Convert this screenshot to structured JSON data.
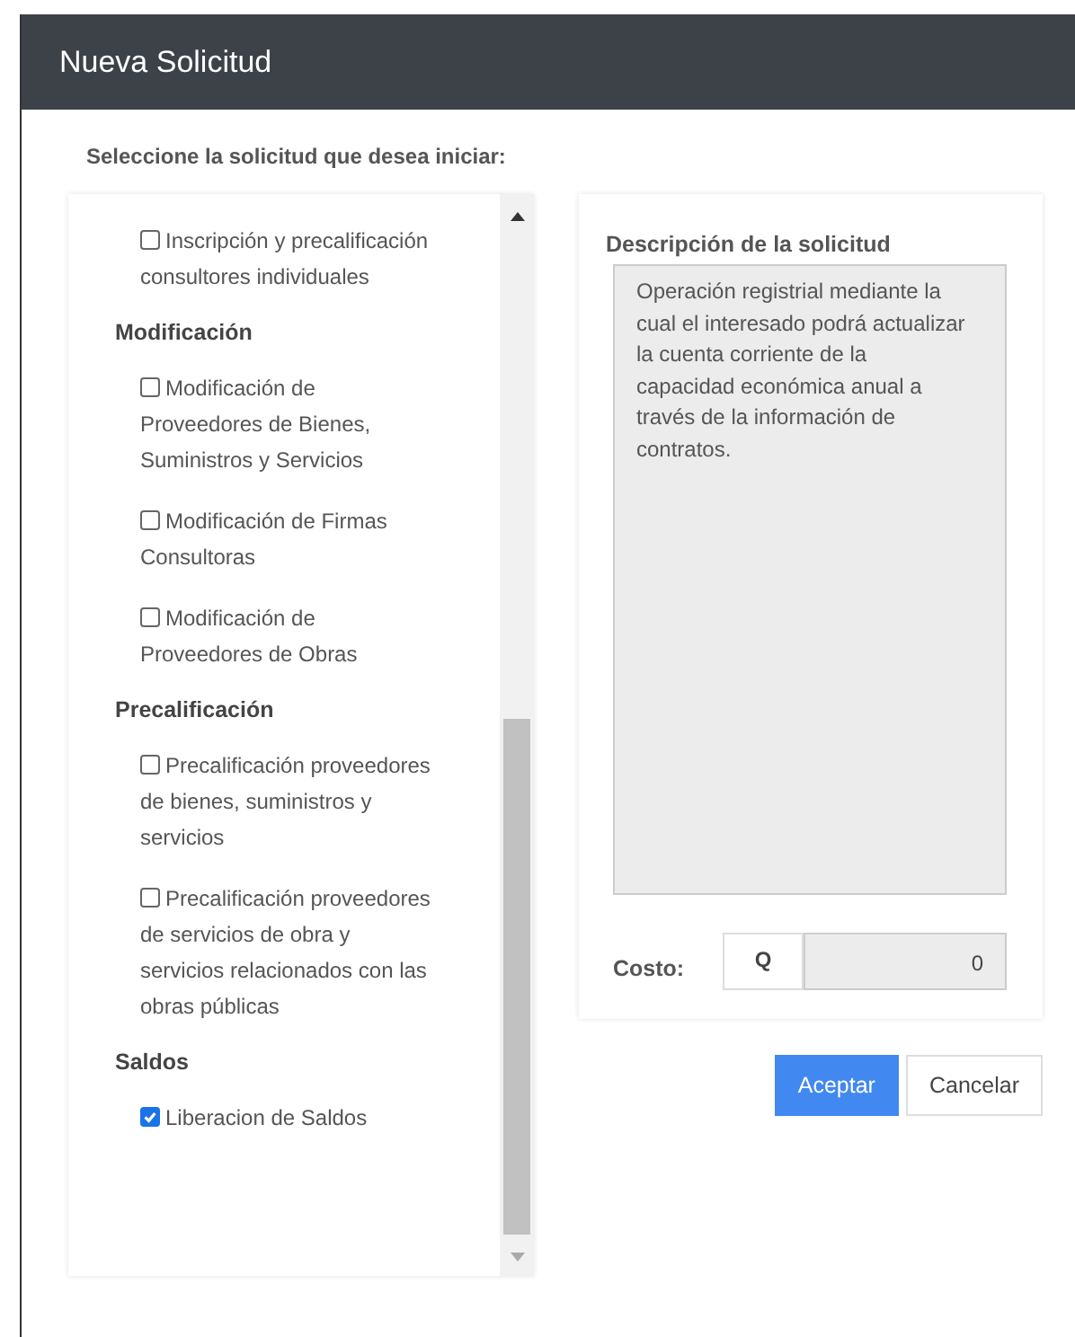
{
  "window": {
    "title": "Nueva Solicitud"
  },
  "prompt": "Seleccione la solicitud que desea iniciar:",
  "groups": [
    {
      "items": [
        {
          "label": "Inscripción y precalificación consultores individuales",
          "checked": false
        }
      ]
    },
    {
      "heading": "Modificación",
      "items": [
        {
          "label": "Modificación de Proveedores de Bienes, Suministros y Servicios",
          "checked": false
        },
        {
          "label": "Modificación de Firmas Consultoras",
          "checked": false
        },
        {
          "label": "Modificación de Proveedores de Obras",
          "checked": false
        }
      ]
    },
    {
      "heading": "Precalificación",
      "items": [
        {
          "label": "Precalificación proveedores de bienes, suministros y servicios",
          "checked": false
        },
        {
          "label": "Precalificación proveedores de servicios de obra y servicios relacionados con las obras públicas",
          "checked": false
        }
      ]
    },
    {
      "heading": "Saldos",
      "items": [
        {
          "label": "Liberacion de Saldos",
          "checked": true
        }
      ]
    }
  ],
  "description": {
    "label": "Descripción de la solicitud",
    "value": "Operación registrial mediante la cual el interesado podrá actualizar la cuenta corriente de la capacidad económica anual a través de la información de contratos."
  },
  "cost": {
    "label": "Costo:",
    "currency": "Q",
    "value": "0"
  },
  "buttons": [
    {
      "label": "Aceptar",
      "kind": "primary"
    },
    {
      "label": "Cancelar",
      "kind": "secondary"
    }
  ]
}
